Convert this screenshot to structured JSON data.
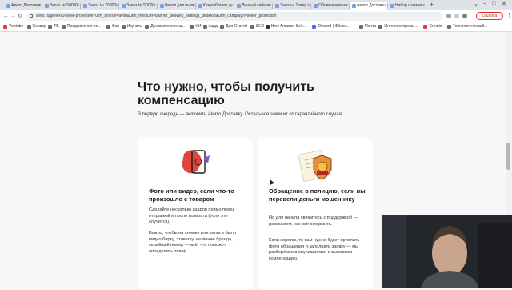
{
  "browser": {
    "tabs": [
      {
        "label": "Авито Доставка"
      },
      {
        "label": "Заказ № 50000"
      },
      {
        "label": "Заказ № 70000"
      },
      {
        "label": "Заказ № 50000"
      },
      {
        "label": "Чехол для пыле..."
      },
      {
        "label": "Как работает д..."
      },
      {
        "label": "Личный кабине..."
      },
      {
        "label": "Заказы: Товар..."
      },
      {
        "label": "Объявление на..."
      },
      {
        "label": "Авито Доставк..."
      },
      {
        "label": "Набор шахмат..."
      }
    ],
    "active_tab_index": 9,
    "url": "avito.ru/general/seller-protection?utm_source=avito&utm_medium=banner_delivery_settings_desktop&utm_campaign=seller_protection",
    "error_button": "Ошибка",
    "bookmarks": [
      {
        "label": "Youtube",
        "color": "#e53935"
      },
      {
        "label": "Сервер",
        "color": "#6d6d6d"
      },
      {
        "label": "ЛК",
        "color": "#6d6d6d"
      },
      {
        "label": "Продвижения ст...",
        "color": "#6d6d6d"
      },
      {
        "label": "Фин",
        "color": "#6d6d6d"
      },
      {
        "label": "Изучить",
        "color": "#6d6d6d"
      },
      {
        "label": "Динамическое ш...",
        "color": "#6d6d6d"
      },
      {
        "label": "ИИ",
        "color": "#6d6d6d"
      },
      {
        "label": "Азрд",
        "color": "#6d6d6d"
      },
      {
        "label": "Для Статей",
        "color": "#6d6d6d"
      },
      {
        "label": "SEO",
        "color": "#6d6d6d"
      },
      {
        "label": "How Amazon Sell...",
        "color": "#333333"
      },
      {
        "label": "Discord | Фбокс...",
        "color": "#5865f2"
      },
      {
        "label": "Почта",
        "color": "#6d6d6d"
      },
      {
        "label": "Интернет проми...",
        "color": "#6d6d6d"
      },
      {
        "label": "Creatio",
        "color": "#e53935"
      },
      {
        "label": "Технологический...",
        "color": "#6d6d6d"
      }
    ]
  },
  "page": {
    "heading": "Что нужно, чтобы получить компенсацию",
    "subtitle": "В первую очередь — включить Авито Доставку. Остальное зависит от гарантийного случая.",
    "cards": [
      {
        "title": "Фото или видео, если что-то произошло с товаром",
        "paragraphs": [
          "Сделайте несколько кадров прямо перед отправкой и после возврата (если это случится).",
          "Важно, чтобы на снимке или записи было видно бирку, этикетку, название бренда, серийный номер — всё, что поможет определить товар."
        ],
        "icon": "phone-camera-icon"
      },
      {
        "title": "Обращение в полицию, если вы перевели деньги мошеннику",
        "paragraphs": [
          "Но для начала свяжитесь с поддержкой — расскажем, как всё оформить.",
          "Если коротко, то вам нужно будет прислать фото обращения и заполнить заявку — мы разберёмся в случившемся и выплатим компенсацию."
        ],
        "icon": "police-badge-document-icon"
      }
    ]
  },
  "colors": {
    "accent_blue": "#6fa6e4",
    "error_red": "#d93025",
    "illustration_red": "#e0453e",
    "illustration_purple": "#8a4fd0",
    "badge_orange": "#e8903a"
  }
}
